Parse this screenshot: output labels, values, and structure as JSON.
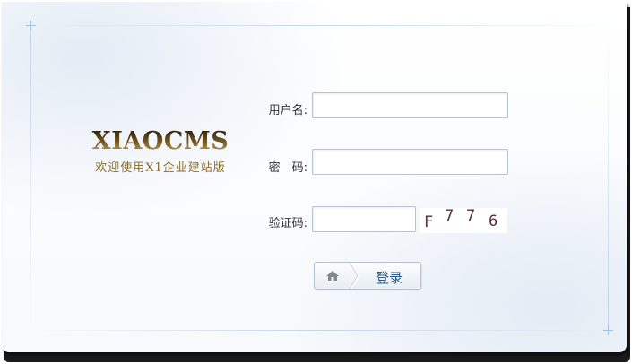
{
  "brand": {
    "title": "XIAOCMS",
    "subtitle": "欢迎使用X1企业建站版"
  },
  "form": {
    "username_label": "用户名:",
    "username_value": "",
    "password_label": "密　码:",
    "password_value": "",
    "captcha_label": "验证码:",
    "captcha_value": "",
    "captcha_chars": [
      "F",
      "7",
      "7",
      "6"
    ],
    "submit_label": "登录"
  },
  "icons": {
    "submit_icon": "home-icon"
  },
  "colors": {
    "brand_gold": "#8a6d2b",
    "button_text": "#2a5a86",
    "captcha_text": "#5c2a3c",
    "input_border": "#b9c3cd"
  }
}
